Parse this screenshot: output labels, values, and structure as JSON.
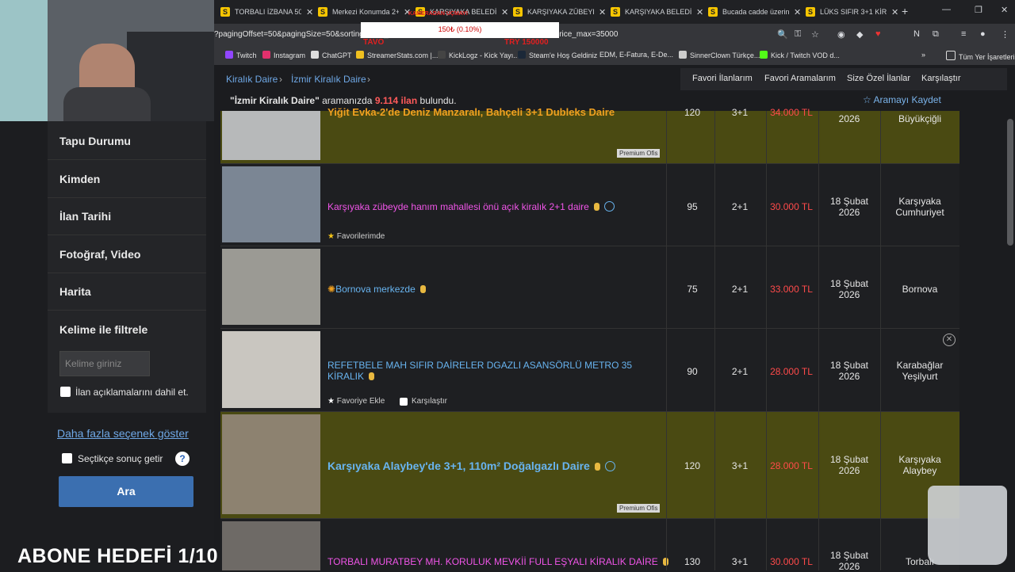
{
  "browser": {
    "tabs": [
      "TORBALI İZBANA 50N",
      "Merkezi Konumda 2+",
      "KARŞIYAKA BELEDİYE",
      "KARŞIYAKA ZÜBEYDE",
      "KARŞIYAKA BELEDİYE",
      "Bucada cadde üzerin",
      "LÜKS SIFIR 3+1 KİRA"
    ],
    "url": "?pagingOffset=50&pagingSize=50&sorting=date_desc&a20=38474&a20=1227924&a20=38486&price_max=35000",
    "bookmarks": [
      "Twitch",
      "Instagram",
      "ChatGPT",
      "StreamerStats.com |...",
      "KickLogz - Kick Yayı...",
      "Steam'e Hoş Geldiniz",
      "EDM, E-Fatura, E-De...",
      "SinnerClown Türkçe...",
      "Kick / Twitch VOD d...",
      "Tüm Yer İşaretleri"
    ]
  },
  "overlay": {
    "goal_box": "150₺ (0.10%)",
    "label_top": "KAMERADAN UÇMAYI",
    "left_red": "TAVO",
    "right_red": "TRY 150000"
  },
  "breadcrumb": {
    "item1": "Kiralık Daire",
    "item2": "İzmir Kiralık Daire"
  },
  "topnav": {
    "fav_listings": "Favori İlanlarım",
    "fav_searches": "Favori Aramalarım",
    "special": "Size Özel İlanlar",
    "compare": "Karşılaştır"
  },
  "result": {
    "query": "\"İzmir Kiralık Daire\"",
    "middle": " aramanızda ",
    "count": "9.114 ilan",
    "suffix": " bulundu."
  },
  "save_search": "Aramayı Kaydet",
  "sidebar": {
    "items": [
      "Tapu Durumu",
      "Kimden",
      "İlan Tarihi",
      "Fotoğraf, Video",
      "Harita",
      "Kelime ile filtrele"
    ],
    "keyword_placeholder": "Kelime giriniz",
    "include_desc": "İlan açıklamalarını dahil et.",
    "more_options": "Daha fazla seçenek göster",
    "auto_results": "Seçtikçe sonuç getir",
    "search_button": "Ara"
  },
  "listings": [
    {
      "title": "Yiğit Evka-2'de Deniz Manzaralı, Bahçeli 3+1 Dubleks Daire",
      "size": "120",
      "rooms": "3+1",
      "price": "34.000 TL",
      "date": "2026",
      "location": "Büyükçiğli",
      "badge": "Premium Ofis"
    },
    {
      "title": "Karşıyaka zübeyde hanım mahallesi önü açık kiralık 2+1 daire",
      "size": "95",
      "rooms": "2+1",
      "price": "30.000 TL",
      "date_day": "18 Şubat",
      "date_year": "2026",
      "loc1": "Karşıyaka",
      "loc2": "Cumhuriyet",
      "fav": "Favorilerimde"
    },
    {
      "title": "Bornova merkezde",
      "size": "75",
      "rooms": "2+1",
      "price": "33.000 TL",
      "date_day": "18 Şubat",
      "date_year": "2026",
      "loc1": "Bornova"
    },
    {
      "title1": "REFETBELE MAH SIFIR DAİRELER DGAZLI ASANSÖRLÜ METRO 35",
      "title2": "KİRALIK",
      "size": "90",
      "rooms": "2+1",
      "price": "28.000 TL",
      "date_day": "18 Şubat",
      "date_year": "2026",
      "loc1": "Karabağlar",
      "loc2": "Yeşilyurt",
      "fav": "Favoriye Ekle",
      "compare": "Karşılaştır"
    },
    {
      "title": "Karşıyaka Alaybey'de 3+1, 110m² Doğalgazlı Daire",
      "size": "120",
      "rooms": "3+1",
      "price": "28.000 TL",
      "date_day": "18 Şubat",
      "date_year": "2026",
      "loc1": "Karşıyaka",
      "loc2": "Alaybey",
      "badge": "Premium Ofis"
    },
    {
      "title": "TORBALI MURATBEY MH. KORULUK MEVKİİ FULL EŞYALI KİRALIK DAİRE",
      "size": "130",
      "rooms": "3+1",
      "price": "30.000 TL",
      "date_day": "18 Şubat",
      "date_year": "2026",
      "loc1": "Torbalı"
    }
  ],
  "stream": {
    "goal": "ABONE HEDEFİ 1/10"
  }
}
